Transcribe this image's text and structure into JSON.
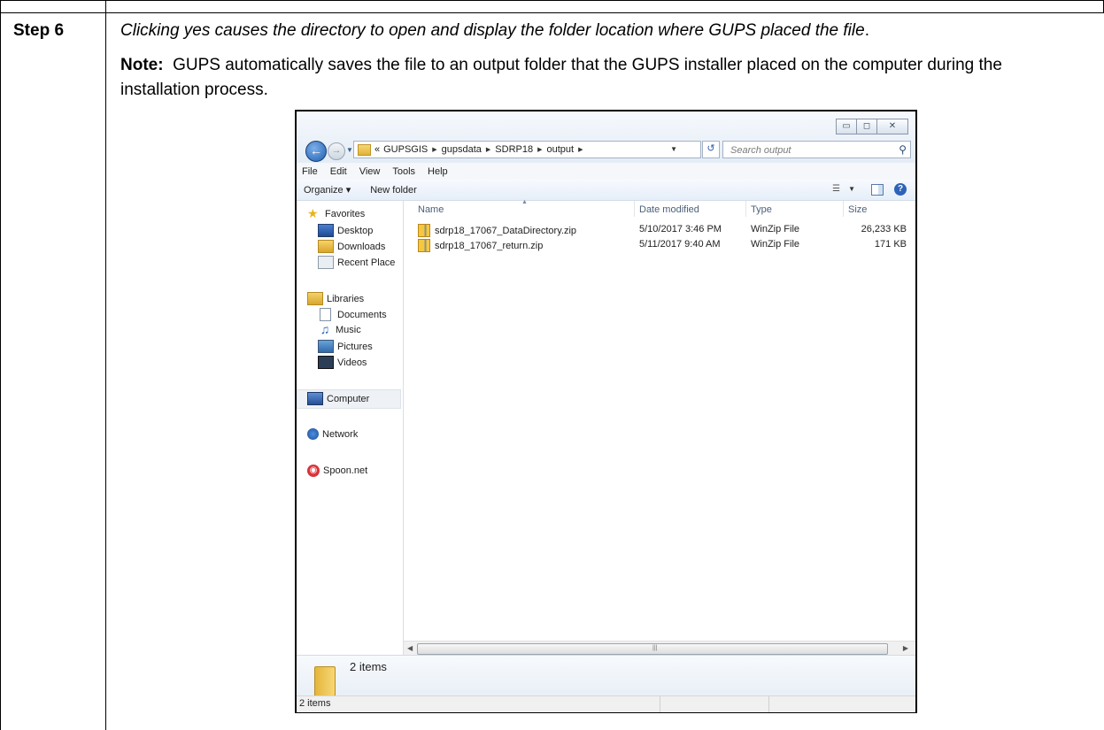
{
  "step": {
    "label": "Step 6",
    "instruction": "Clicking yes causes the directory to open and display the folder location where GUPS placed the file",
    "instruction_end": ".",
    "note_label": "Note:",
    "note_text": "  GUPS automatically saves the file to an output folder that the GUPS installer placed on the computer during the installation process."
  },
  "window": {
    "controls": {
      "minimize": "▭",
      "maximize": "◻",
      "close": "✕"
    },
    "address": {
      "overflow": "«",
      "crumbs": [
        "GUPSGIS",
        "gupsdata",
        "SDRP18",
        "output"
      ]
    },
    "search": {
      "placeholder": "Search output"
    },
    "menu": [
      "File",
      "Edit",
      "View",
      "Tools",
      "Help"
    ],
    "commands": {
      "organize": "Organize ▾",
      "new_folder": "New folder"
    },
    "nav": {
      "favorites": "Favorites",
      "desktop": "Desktop",
      "downloads": "Downloads",
      "recent": "Recent Place",
      "libraries": "Libraries",
      "documents": "Documents",
      "music": "Music",
      "pictures": "Pictures",
      "videos": "Videos",
      "computer": "Computer",
      "network": "Network",
      "spoon": "Spoon.net"
    },
    "columns": {
      "name": "Name",
      "date": "Date modified",
      "type": "Type",
      "size": "Size"
    },
    "files": [
      {
        "name": "sdrp18_17067_DataDirectory.zip",
        "date": "5/10/2017 3:46 PM",
        "type": "WinZip File",
        "size": "26,233 KB"
      },
      {
        "name": "sdrp18_17067_return.zip",
        "date": "5/11/2017 9:40 AM",
        "type": "WinZip File",
        "size": "171 KB"
      }
    ],
    "details_count": "2 items",
    "status": "2 items"
  }
}
